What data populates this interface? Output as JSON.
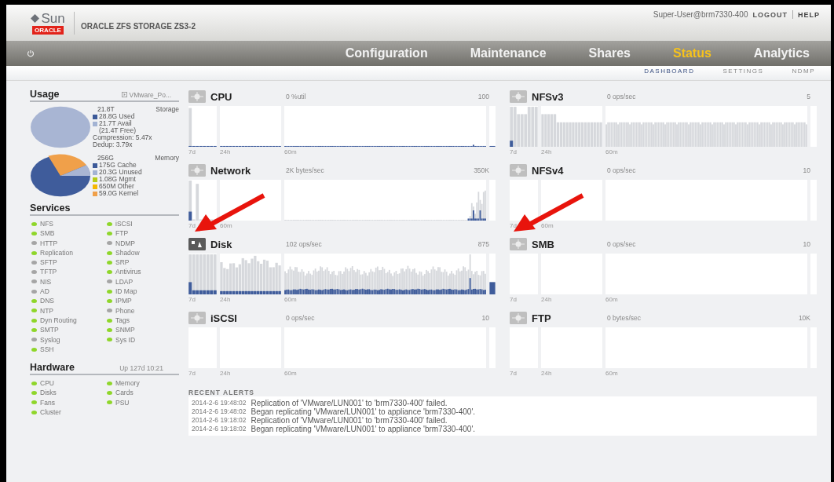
{
  "header": {
    "brand": "Sun",
    "brand_sub": "ORACLE",
    "product": "ORACLE ZFS STORAGE ZS3-2",
    "user": "Super-User@brm7330-400",
    "logout": "LOGOUT",
    "help": "HELP"
  },
  "nav": [
    {
      "label": "Configuration",
      "selected": false
    },
    {
      "label": "Maintenance",
      "selected": false
    },
    {
      "label": "Shares",
      "selected": false
    },
    {
      "label": "Status",
      "selected": true
    },
    {
      "label": "Analytics",
      "selected": false
    }
  ],
  "subnav": [
    {
      "label": "DASHBOARD",
      "selected": true
    },
    {
      "label": "SETTINGS",
      "selected": false
    },
    {
      "label": "NDMP",
      "selected": false
    }
  ],
  "usage": {
    "title": "Usage",
    "pool": "VMware_Po...",
    "storage": {
      "total": "21.8T",
      "label": "Storage",
      "legend": [
        {
          "text": "28.8G Used",
          "color": "#3d5a99"
        },
        {
          "text": "21.7T Avail",
          "color": "#a3b3d3"
        }
      ],
      "notes": [
        "(21.4T Free)",
        "Compression: 5.47x",
        "Dedup: 3.79x"
      ]
    },
    "memory": {
      "total": "256G",
      "label": "Memory",
      "legend": [
        {
          "text": "175G Cache",
          "color": "#3d5a99"
        },
        {
          "text": "20.3G Unused",
          "color": "#a3b3d3"
        },
        {
          "text": "1.08G Mgmt",
          "color": "#b5cc18"
        },
        {
          "text": "650M Other",
          "color": "#f5b800"
        },
        {
          "text": "59.0G Kernel",
          "color": "#f0a04a"
        }
      ]
    }
  },
  "services": {
    "title": "Services",
    "items": [
      {
        "name": "NFS",
        "on": true
      },
      {
        "name": "iSCSI",
        "on": true
      },
      {
        "name": "SMB",
        "on": true
      },
      {
        "name": "FTP",
        "on": true
      },
      {
        "name": "HTTP",
        "on": false
      },
      {
        "name": "NDMP",
        "on": false
      },
      {
        "name": "Replication",
        "on": true
      },
      {
        "name": "Shadow",
        "on": true
      },
      {
        "name": "SFTP",
        "on": false
      },
      {
        "name": "SRP",
        "on": true
      },
      {
        "name": "TFTP",
        "on": false
      },
      {
        "name": "Antivirus",
        "on": true
      },
      {
        "name": "NIS",
        "on": false
      },
      {
        "name": "LDAP",
        "on": false
      },
      {
        "name": "AD",
        "on": false
      },
      {
        "name": "ID Map",
        "on": true
      },
      {
        "name": "DNS",
        "on": true
      },
      {
        "name": "IPMP",
        "on": true
      },
      {
        "name": "NTP",
        "on": true
      },
      {
        "name": "Phone",
        "on": false
      },
      {
        "name": "Dyn Routing",
        "on": true
      },
      {
        "name": "Tags",
        "on": true
      },
      {
        "name": "SMTP",
        "on": true
      },
      {
        "name": "SNMP",
        "on": true
      },
      {
        "name": "Syslog",
        "on": false
      },
      {
        "name": "Sys ID",
        "on": true
      },
      {
        "name": "SSH",
        "on": true
      }
    ]
  },
  "hardware": {
    "title": "Hardware",
    "uptime": "Up 127d 10:21",
    "items": [
      {
        "name": "CPU",
        "on": true
      },
      {
        "name": "Memory",
        "on": true
      },
      {
        "name": "Disks",
        "on": true
      },
      {
        "name": "Cards",
        "on": true
      },
      {
        "name": "Fans",
        "on": true
      },
      {
        "name": "PSU",
        "on": true
      },
      {
        "name": "Cluster",
        "on": true
      }
    ]
  },
  "charts": [
    {
      "title": "CPU",
      "reading": "0 %util",
      "max": "100",
      "active": false,
      "kind": "idle",
      "axis": [
        "7d",
        "24h",
        "60m"
      ]
    },
    {
      "title": "NFSv3",
      "reading": "0 ops/sec",
      "max": "5",
      "active": false,
      "kind": "flat",
      "axis": [
        "7d",
        "24h",
        "60m"
      ]
    },
    {
      "title": "Network",
      "reading": "2K bytes/sec",
      "max": "350K",
      "active": false,
      "kind": "sparse",
      "axis": [
        "7d",
        "60m"
      ]
    },
    {
      "title": "NFSv4",
      "reading": "0 ops/sec",
      "max": "10",
      "active": false,
      "kind": "empty",
      "axis": [
        "7d",
        "60m"
      ]
    },
    {
      "title": "Disk",
      "reading": "102 ops/sec",
      "max": "875",
      "active": true,
      "kind": "busy",
      "axis": [
        "7d",
        "24h",
        "60m"
      ]
    },
    {
      "title": "SMB",
      "reading": "0 ops/sec",
      "max": "10",
      "active": false,
      "kind": "empty",
      "axis": [
        "7d",
        "24h",
        "60m"
      ]
    },
    {
      "title": "iSCSI",
      "reading": "0 ops/sec",
      "max": "10",
      "active": false,
      "kind": "empty",
      "axis": [
        "7d",
        "24h",
        "60m"
      ]
    },
    {
      "title": "FTP",
      "reading": "0 bytes/sec",
      "max": "10K",
      "active": false,
      "kind": "empty",
      "axis": [
        "7d",
        "24h",
        "60m"
      ]
    }
  ],
  "alerts": {
    "title": "RECENT ALERTS",
    "items": [
      {
        "time": "2014-2-6 19:48:02",
        "message": "Replication of 'VMware/LUN001' to 'brm7330-400' failed."
      },
      {
        "time": "2014-2-6 19:48:02",
        "message": "Began replicating 'VMware/LUN001' to appliance 'brm7330-400'."
      },
      {
        "time": "2014-2-6 19:18:02",
        "message": "Replication of 'VMware/LUN001' to 'brm7330-400' failed."
      },
      {
        "time": "2014-2-6 19:18:02",
        "message": "Began replicating 'VMware/LUN001' to appliance 'brm7330-400'."
      }
    ]
  }
}
